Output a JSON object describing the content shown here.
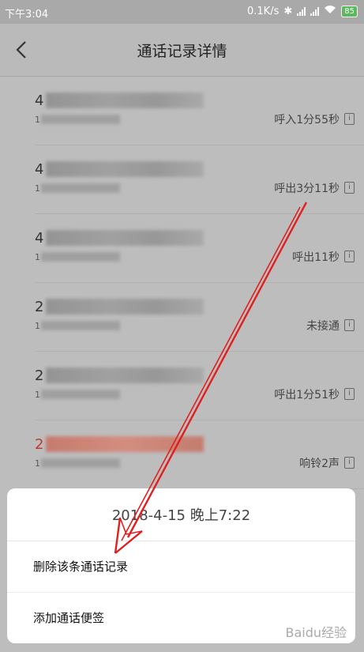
{
  "status_bar": {
    "time": "下午3:04",
    "speed": "0.1K/s",
    "battery": "85"
  },
  "header": {
    "title": "通话记录详情"
  },
  "records": [
    {
      "number_prefix": "4",
      "sub_prefix": "1",
      "status": "呼入1分55秒",
      "red": false
    },
    {
      "number_prefix": "4",
      "sub_prefix": "1",
      "status": "呼出3分11秒",
      "red": false
    },
    {
      "number_prefix": "4",
      "sub_prefix": "1",
      "status": "呼出11秒",
      "red": false
    },
    {
      "number_prefix": "2",
      "sub_prefix": "1",
      "status": "未接通",
      "red": false
    },
    {
      "number_prefix": "2",
      "sub_prefix": "1",
      "status": "呼出1分51秒",
      "red": false
    },
    {
      "number_prefix": "2",
      "sub_prefix": "1",
      "status": "响铃2声",
      "red": true
    }
  ],
  "sheet": {
    "date": "2018-4-15 晚上7:22",
    "delete_label": "删除该条通话记录",
    "add_note_label": "添加通话便签"
  },
  "watermark": "Baidu经验"
}
